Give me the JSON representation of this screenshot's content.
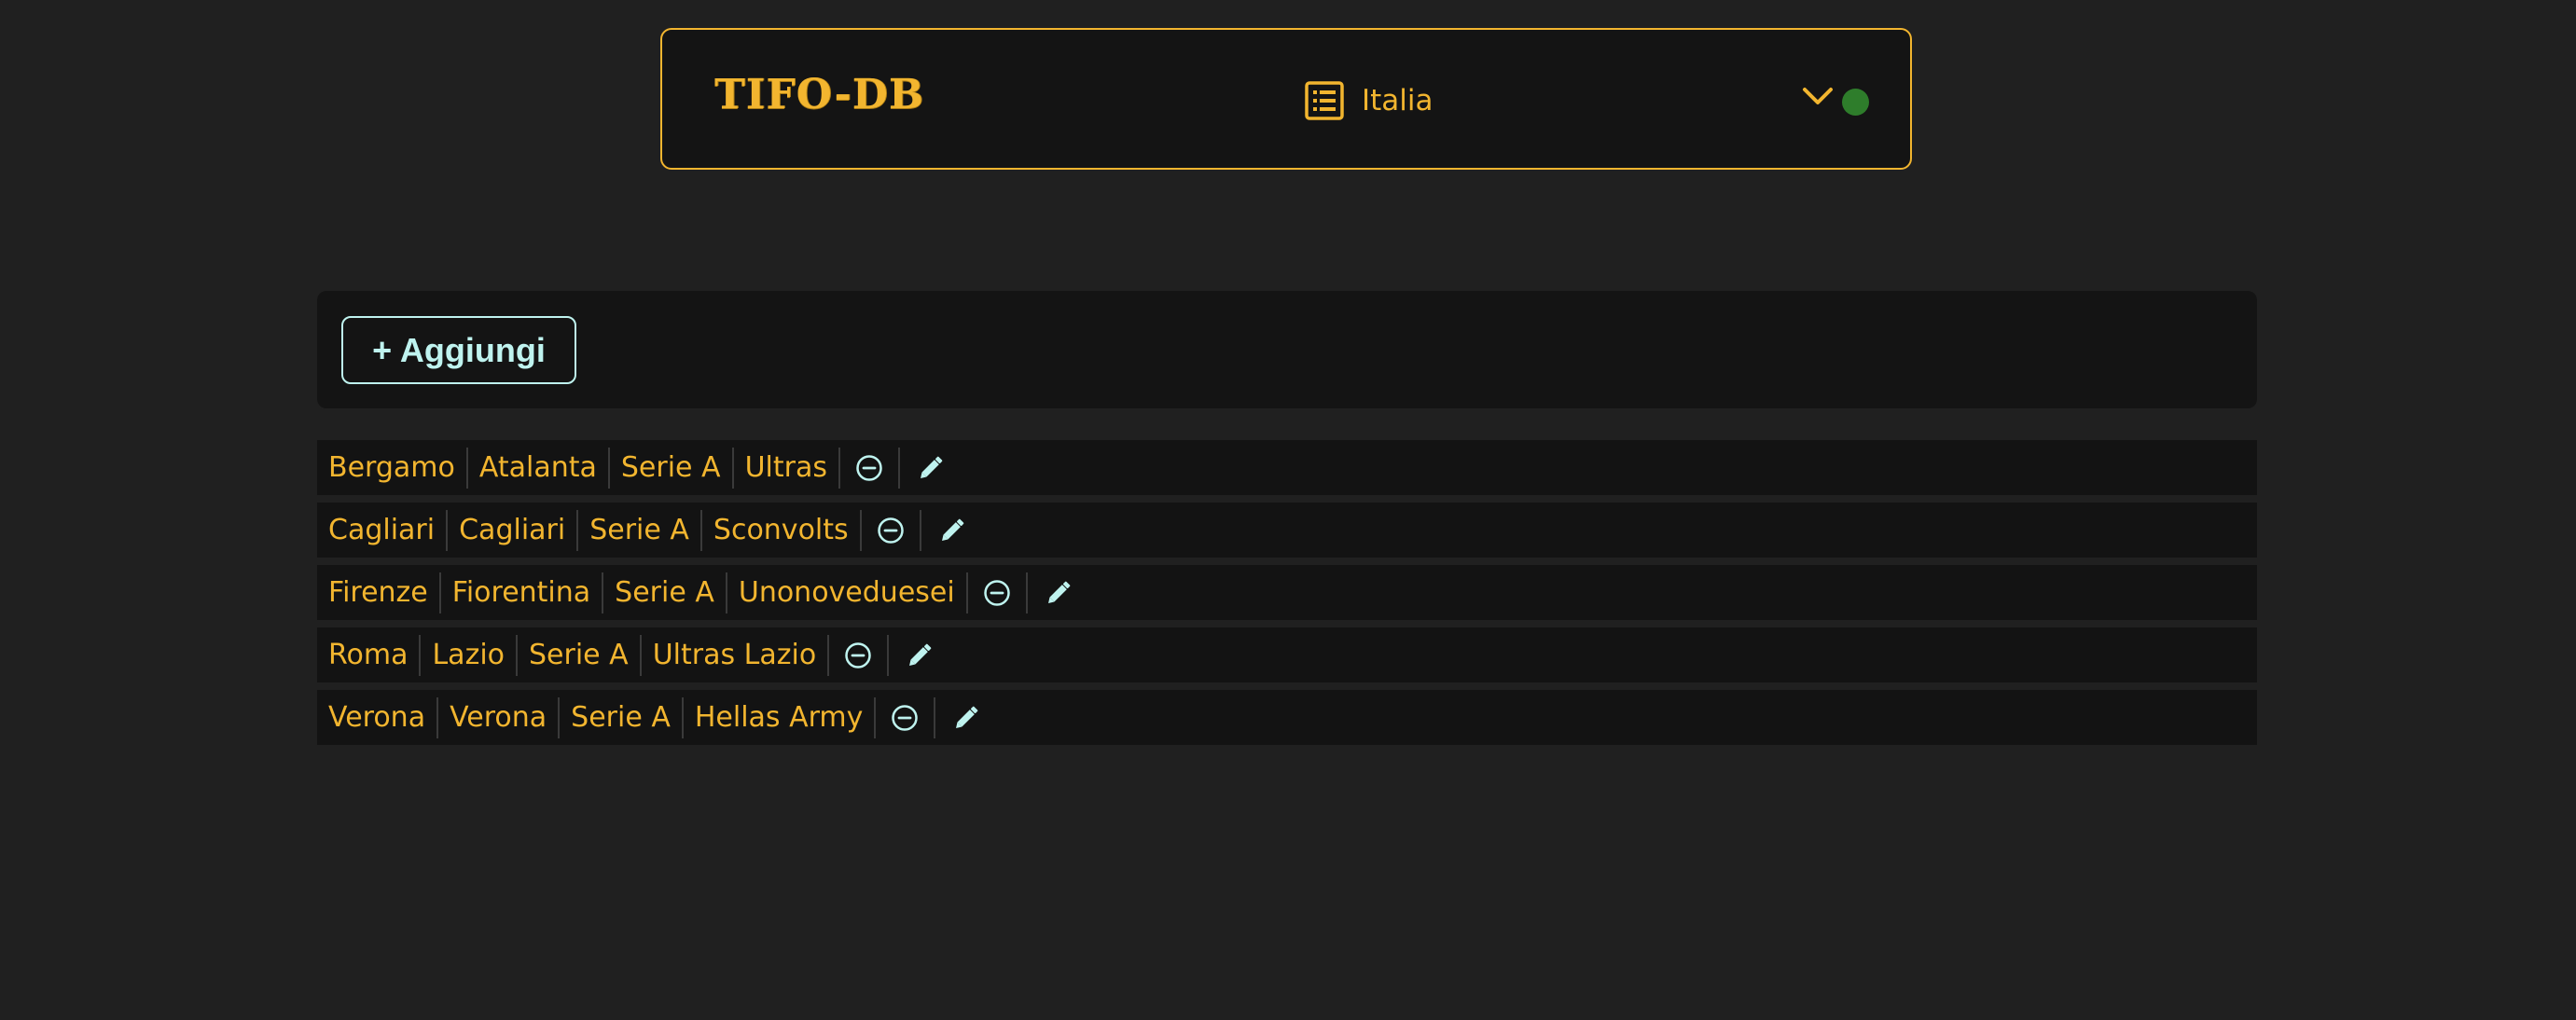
{
  "header": {
    "logo": "TIFO-DB",
    "nav_label": "Italia",
    "icons": {
      "nav": "list-icon",
      "dropdown": "chevron-down-icon",
      "status": "status-dot"
    },
    "status_color": "#2e7d2b"
  },
  "toolbar": {
    "add_label": "+ Aggiungi"
  },
  "rows": [
    {
      "city": "Bergamo",
      "team": "Atalanta",
      "league": "Serie A",
      "group": "Ultras"
    },
    {
      "city": "Cagliari",
      "team": "Cagliari",
      "league": "Serie A",
      "group": "Sconvolts"
    },
    {
      "city": "Firenze",
      "team": "Fiorentina",
      "league": "Serie A",
      "group": "Unonoveduesei"
    },
    {
      "city": "Roma",
      "team": "Lazio",
      "league": "Serie A",
      "group": "Ultras Lazio"
    },
    {
      "city": "Verona",
      "team": "Verona",
      "league": "Serie A",
      "group": "Hellas Army"
    }
  ],
  "row_icons": {
    "remove": "minus-circle-icon",
    "edit": "pencil-icon"
  },
  "colors": {
    "accent": "#f2b52f",
    "secondary": "#bff3ef",
    "background": "#202020",
    "panel": "#141414"
  }
}
